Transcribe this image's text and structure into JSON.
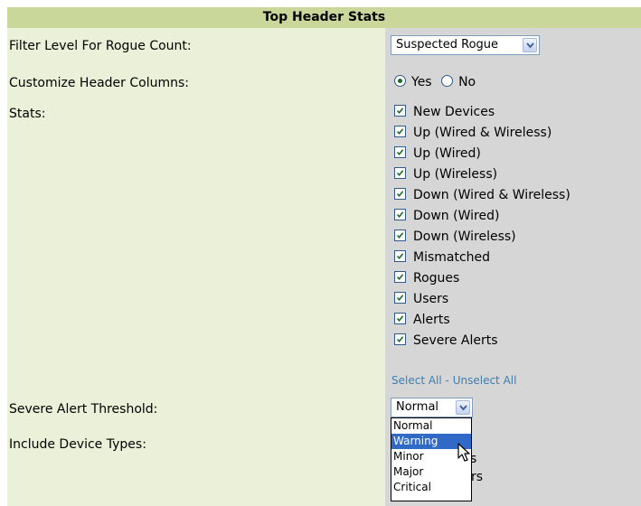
{
  "section": {
    "title": "Top Header Stats"
  },
  "filter_level": {
    "label": "Filter Level For Rogue Count:",
    "selected": "Suspected Rogue"
  },
  "customize_columns": {
    "label": "Customize Header Columns:",
    "options": [
      {
        "label": "Yes",
        "checked": true
      },
      {
        "label": "No",
        "checked": false
      }
    ]
  },
  "stats": {
    "label": "Stats:",
    "items": [
      {
        "label": "New Devices",
        "checked": true
      },
      {
        "label": "Up (Wired & Wireless)",
        "checked": true
      },
      {
        "label": "Up (Wired)",
        "checked": true
      },
      {
        "label": "Up (Wireless)",
        "checked": true
      },
      {
        "label": "Down (Wired & Wireless)",
        "checked": true
      },
      {
        "label": "Down (Wired)",
        "checked": true
      },
      {
        "label": "Down (Wireless)",
        "checked": true
      },
      {
        "label": "Mismatched",
        "checked": true
      },
      {
        "label": "Rogues",
        "checked": true
      },
      {
        "label": "Users",
        "checked": true
      },
      {
        "label": "Alerts",
        "checked": true
      },
      {
        "label": "Severe Alerts",
        "checked": true
      }
    ],
    "select_all": "Select All",
    "separator": "-",
    "unselect_all": "Unselect All"
  },
  "severe_alert_threshold": {
    "label": "Severe Alert Threshold:",
    "selected": "Normal",
    "options": [
      "Normal",
      "Warning",
      "Minor",
      "Major",
      "Critical"
    ],
    "highlighted": "Warning"
  },
  "include_device_types": {
    "label": "Include Device Types:",
    "partial_text_1": "s",
    "partial_text_2": "rs"
  },
  "colors": {
    "header_bg": "#c9d79a",
    "left_bg": "#eaf1d8",
    "right_bg": "#d6d6d6",
    "link": "#3c7fb1",
    "highlight": "#3169c6"
  }
}
